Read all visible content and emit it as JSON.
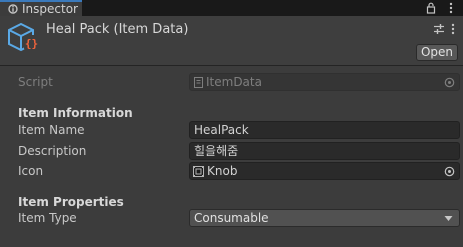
{
  "tab": {
    "label": "Inspector"
  },
  "header": {
    "title": "Heal Pack (Item Data)",
    "open_label": "Open"
  },
  "script_row": {
    "label": "Script",
    "value": "ItemData"
  },
  "sections": {
    "item_information": "Item Information",
    "item_properties": "Item Properties"
  },
  "fields": {
    "item_name": {
      "label": "Item Name",
      "value": "HealPack"
    },
    "description": {
      "label": "Description",
      "value": "힐을해줌"
    },
    "icon": {
      "label": "Icon",
      "value": "Knob"
    },
    "item_type": {
      "label": "Item Type",
      "value": "Consumable"
    }
  },
  "colors": {
    "accent_tab": "#3a79bb",
    "asset_icon_blue": "#5aa9e6",
    "asset_icon_orange": "#f0643c"
  },
  "icons": [
    "inspector-icon",
    "lock-icon",
    "kebab-menu-icon",
    "scriptable-object-icon",
    "settings-icon",
    "more-icon",
    "script-file-icon",
    "object-picker-icon",
    "knob-icon",
    "dropdown-caret-icon"
  ]
}
